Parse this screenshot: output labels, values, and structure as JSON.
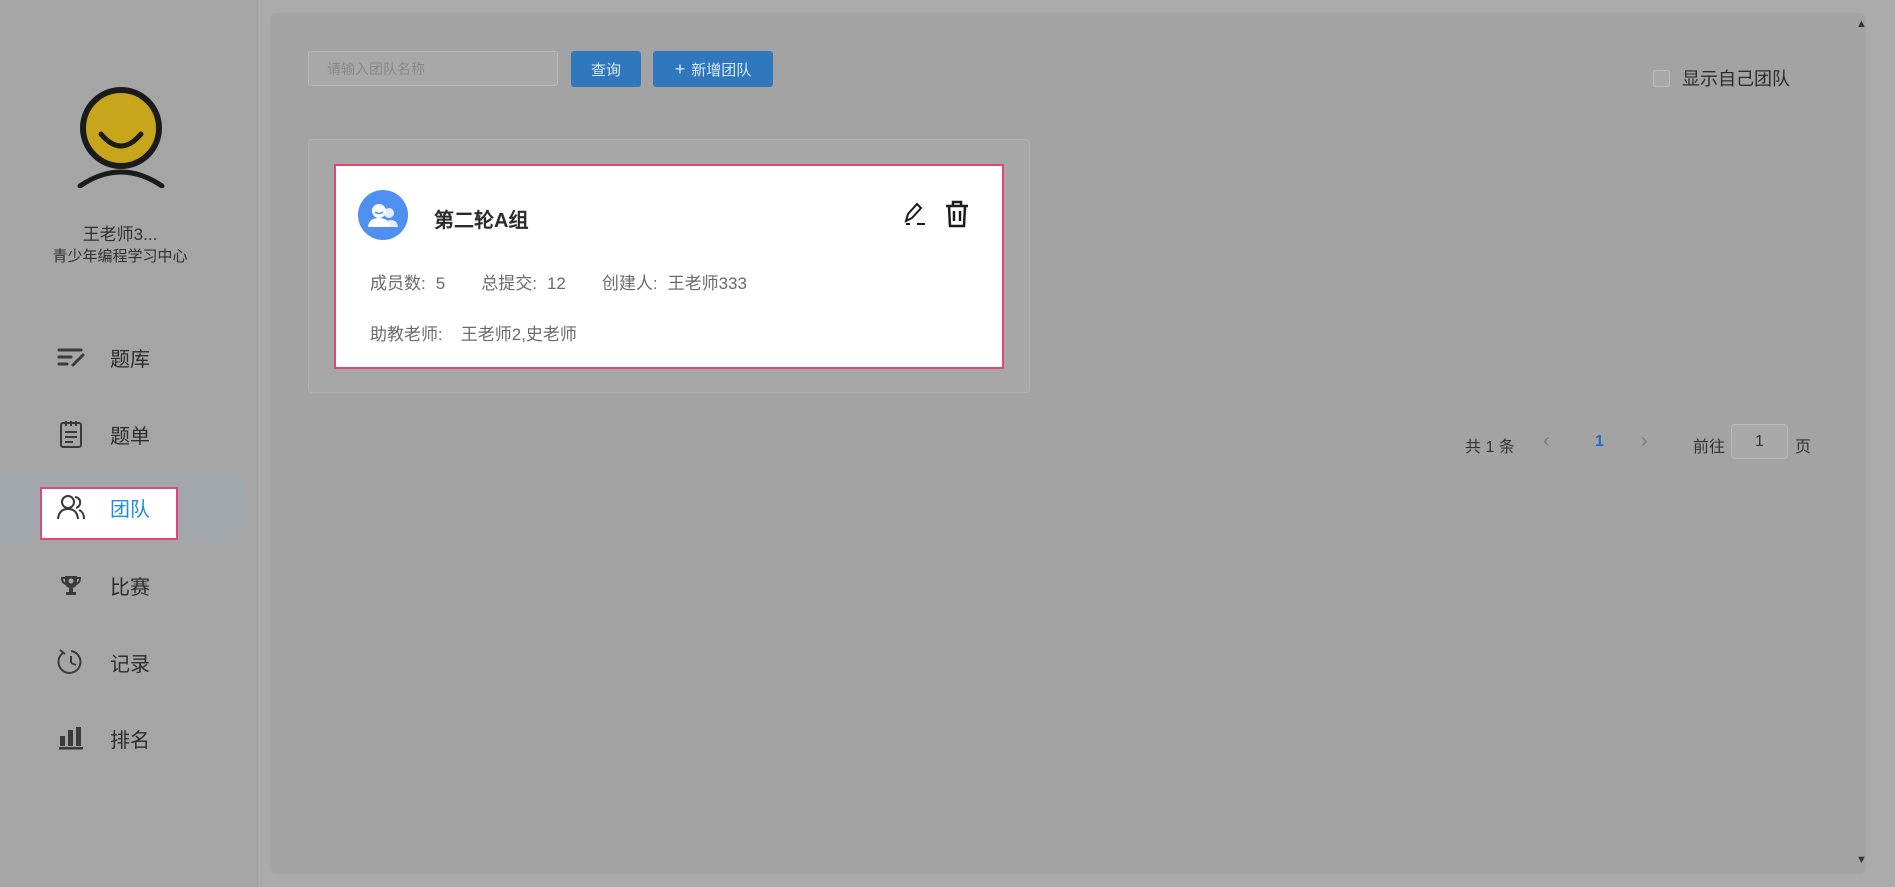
{
  "user": {
    "name": "王老师3...",
    "org": "青少年编程学习中心"
  },
  "nav": {
    "items": [
      {
        "label": "题库",
        "icon": "edit-list-icon"
      },
      {
        "label": "题单",
        "icon": "clipboard-list-icon"
      },
      {
        "label": "团队",
        "icon": "users-icon",
        "active": true
      },
      {
        "label": "比赛",
        "icon": "trophy-icon"
      },
      {
        "label": "记录",
        "icon": "clock-icon"
      },
      {
        "label": "排名",
        "icon": "bar-chart-icon"
      }
    ]
  },
  "toolbar": {
    "search_placeholder": "请输入团队名称",
    "query_label": "查询",
    "add_label": "新增团队",
    "show_own_label": "显示自己团队"
  },
  "team": {
    "name": "第二轮A组",
    "members_label": "成员数:",
    "members_value": "5",
    "submits_label": "总提交:",
    "submits_value": "12",
    "creator_label": "创建人:",
    "creator_value": "王老师333",
    "assistants_label": "助教老师:",
    "assistants_value": "王老师2,史老师"
  },
  "pagination": {
    "total": "共 1 条",
    "current": "1",
    "goto_label": "前往",
    "goto_value": "1",
    "page_suffix": "页"
  },
  "colors": {
    "accent": "#2f78bd",
    "active_text": "#1f8ee0",
    "highlight_border": "#e0457b",
    "team_icon": "#4f8ff0"
  }
}
